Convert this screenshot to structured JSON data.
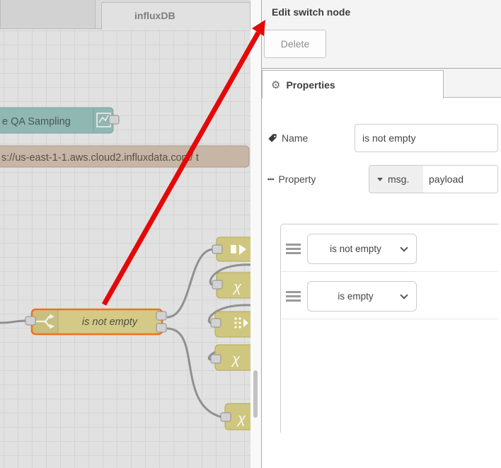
{
  "workspace": {
    "tabs": [
      {
        "label": ""
      },
      {
        "label": "influxDB"
      }
    ],
    "nodes": {
      "chart": {
        "label": "e QA Sampling",
        "icon": "line-chart-icon",
        "fill": "#90b7b2"
      },
      "influxdb": {
        "label": "s://us-east-1-1.aws.cloud2.influxdata.com/ t",
        "fill": "#c7b6a5"
      },
      "switch": {
        "label": "is not empty",
        "icon": "switch-fork-icon",
        "fill": "#d4ca85",
        "selected_border": "#ef7020",
        "outputs": 2
      },
      "stubs": {
        "chi_glyph": "χ"
      }
    }
  },
  "tray": {
    "title": "Edit switch node",
    "toolbar": {
      "delete_label": "Delete"
    },
    "tab": {
      "gear_glyph": "⚙",
      "label": "Properties"
    },
    "fields": {
      "name": {
        "label": "Name",
        "value": "is not empty",
        "icon": "tag-icon"
      },
      "property": {
        "label": "Property",
        "ellipsis_glyph": "•••",
        "type_label": "msg.",
        "value": "payload"
      }
    },
    "rules": [
      {
        "operator": "is not empty"
      },
      {
        "operator": "is empty"
      }
    ]
  },
  "colors": {
    "arrow_red": "#e50808",
    "canvas_bg": "#e1e1e1",
    "wire": "#909090",
    "port_fill": "#d2d2d2",
    "selected_border": "#ef7020"
  }
}
